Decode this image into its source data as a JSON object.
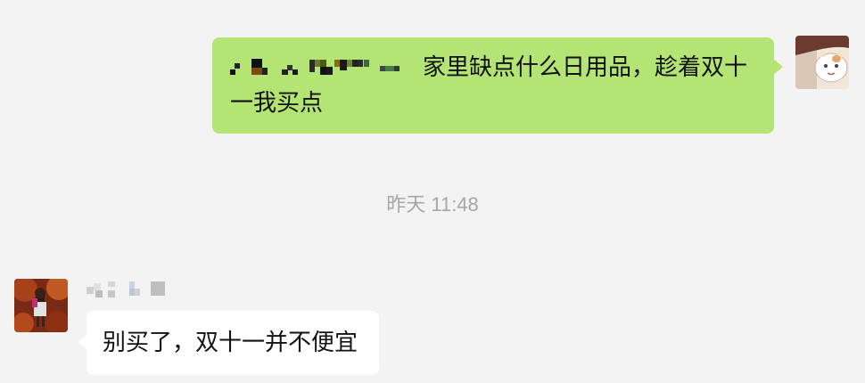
{
  "window": {
    "background": "#f3f3f3"
  },
  "messages": [
    {
      "direction": "outgoing",
      "sender_name_obscured": true,
      "text": "家里缺点什么日用品，趁着双十一我买点",
      "bubble_color": "#b3e474",
      "avatar_icon": "cat-avatar-icon"
    },
    {
      "direction": "incoming",
      "sender_name_obscured": true,
      "text": "别买了，双十一并不便宜",
      "bubble_color": "#ffffff",
      "avatar_icon": "girl-autumn-avatar-icon"
    }
  ],
  "timestamp": {
    "day": "昨天",
    "time": "11:48"
  }
}
